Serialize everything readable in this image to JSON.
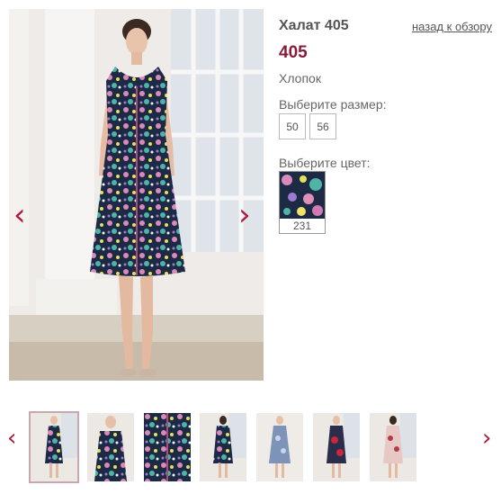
{
  "product": {
    "title": "Халат 405",
    "price": "405",
    "material": "Хлопок",
    "back_label": "назад к обзору"
  },
  "sizes": {
    "label": "Выберите размер:",
    "options": [
      "50",
      "56"
    ]
  },
  "colors": {
    "label": "Выберите цвет:",
    "options": [
      {
        "code": "231"
      }
    ]
  },
  "gallery": {
    "prev_icon": "‹",
    "next_icon": "›",
    "thumb_prev_icon": "‹",
    "thumb_next_icon": "›",
    "thumb_count": 8,
    "active_thumb": 1
  },
  "colors_palette": {
    "accent": "#b0193a",
    "price": "#8a1a3a"
  }
}
